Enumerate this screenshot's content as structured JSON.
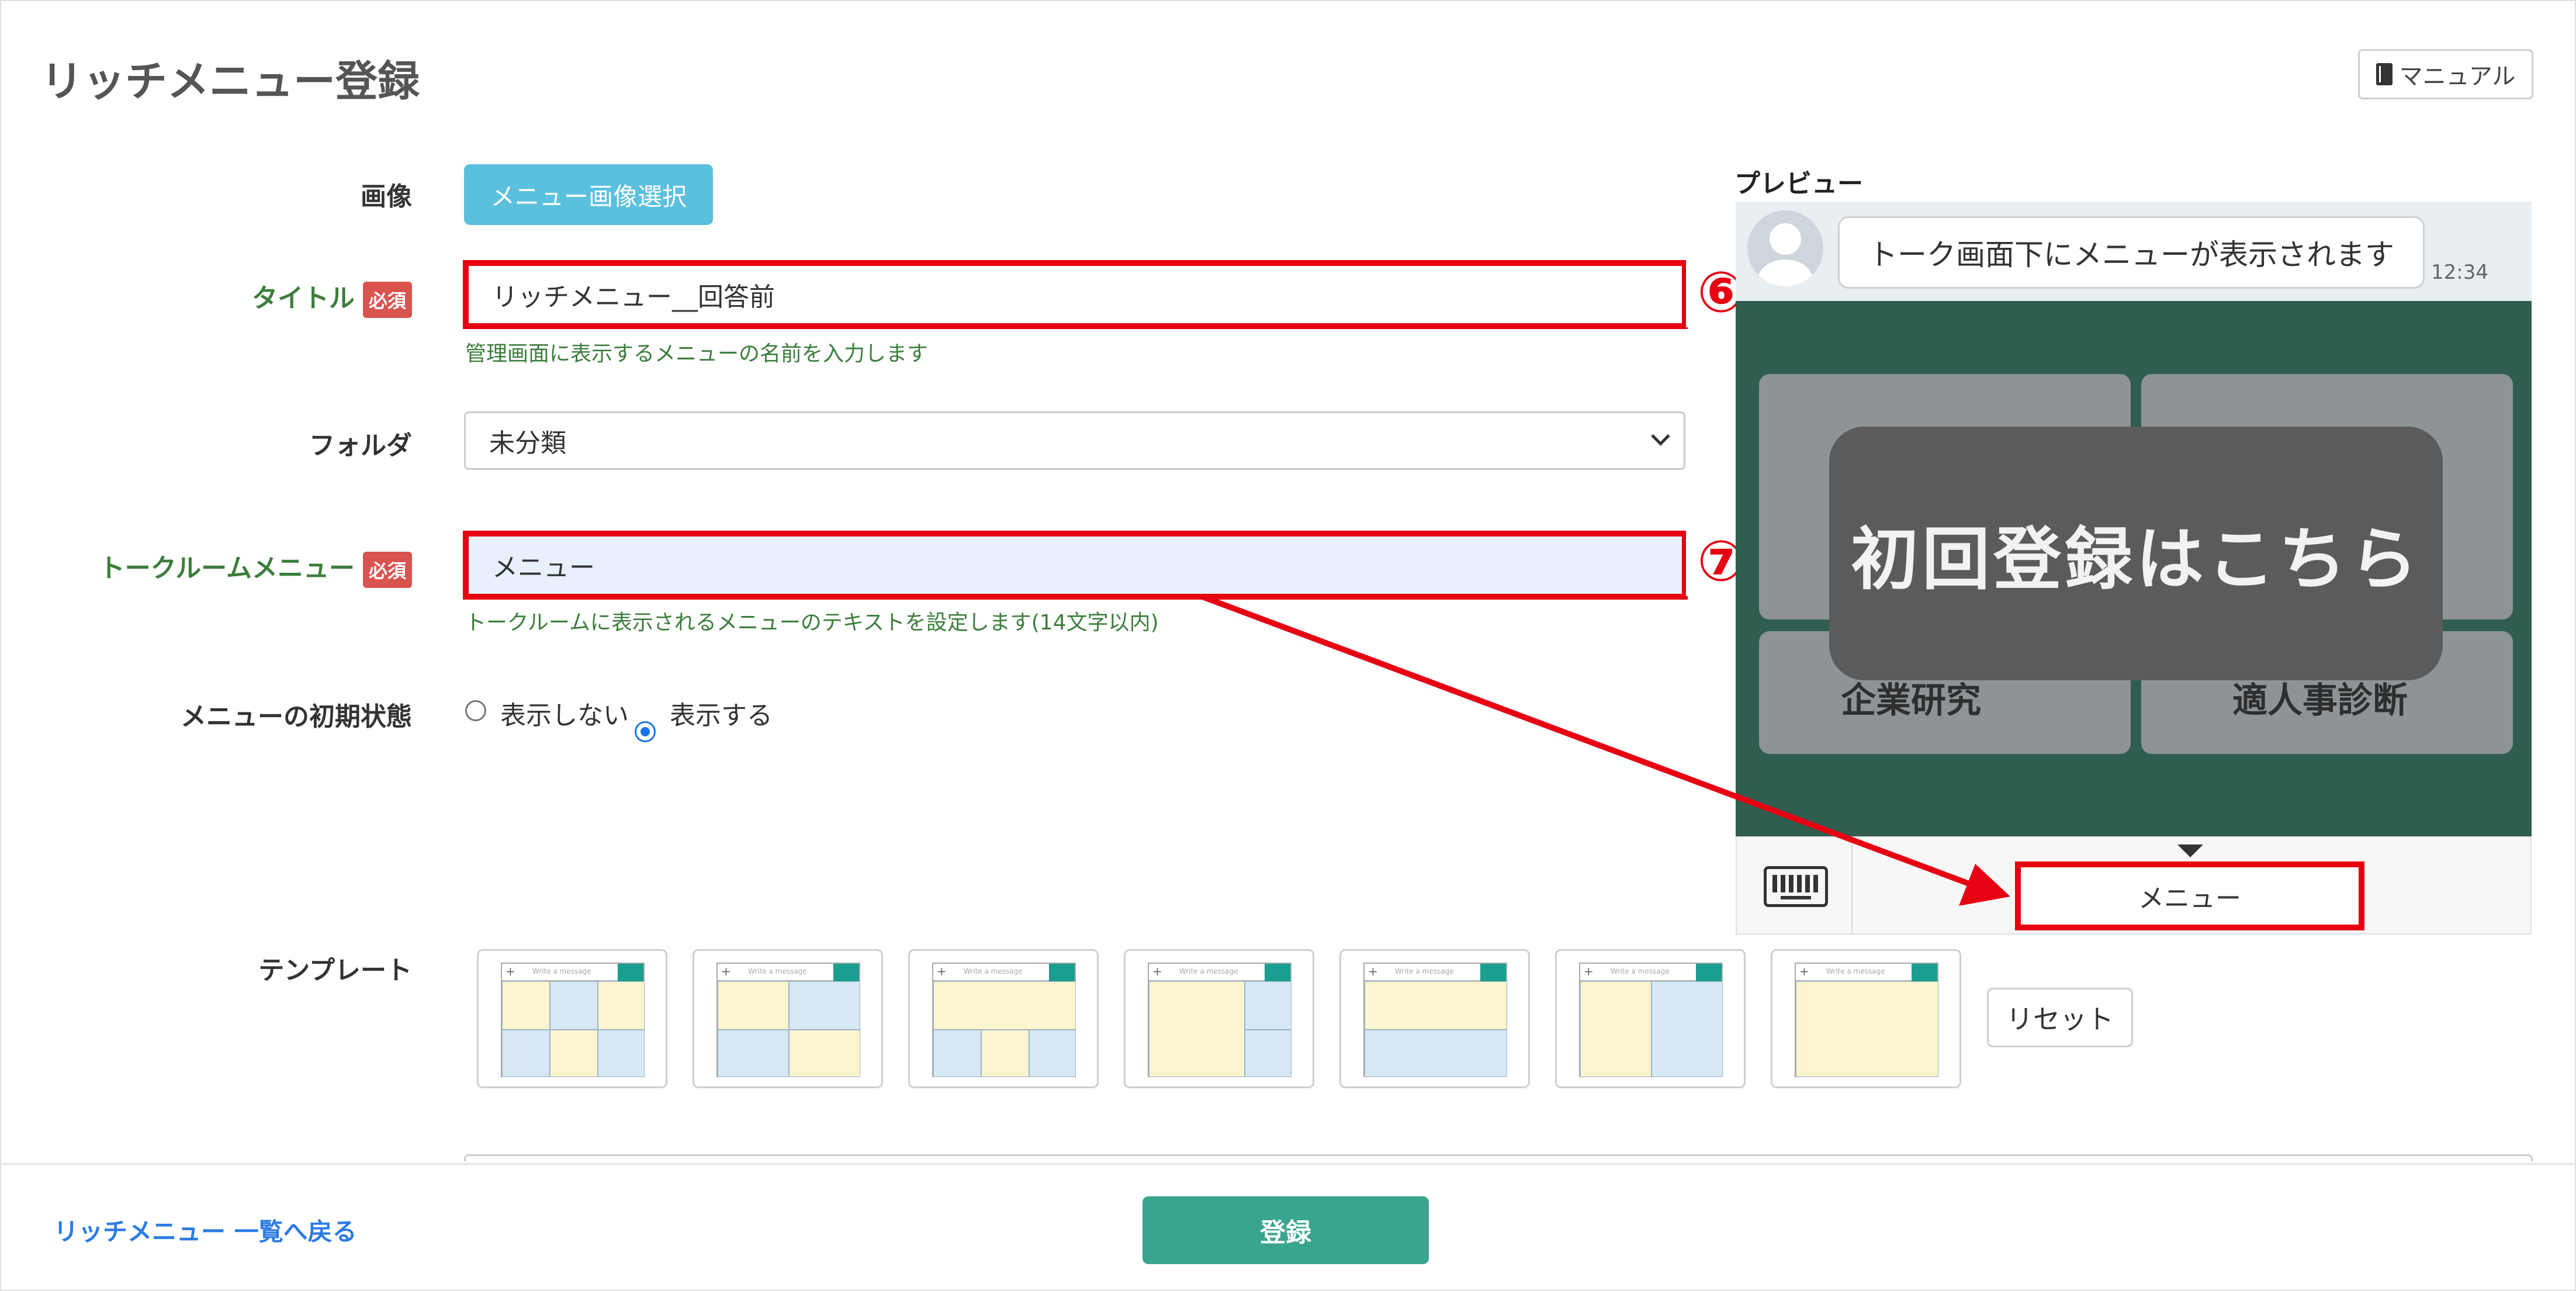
{
  "page": {
    "title": "リッチメニュー登録",
    "manual_label": "マニュアル"
  },
  "form": {
    "image": {
      "label": "画像",
      "button": "メニュー画像選択"
    },
    "title": {
      "label": "タイトル",
      "required": "必須",
      "value": "リッチメニュー__回答前",
      "help": "管理画面に表示するメニューの名前を入力します",
      "marker": "⑥"
    },
    "folder": {
      "label": "フォルダ",
      "selected": "未分類"
    },
    "talkroom_menu": {
      "label": "トークルームメニュー",
      "required": "必須",
      "value": "メニュー",
      "help": "トークルームに表示されるメニューのテキストを設定します(14文字以内)",
      "marker": "⑦"
    },
    "initial_state": {
      "label": "メニューの初期状態",
      "options": [
        "表示しない",
        "表示する"
      ],
      "selected": "表示する"
    },
    "template": {
      "label": "テンプレート",
      "reset": "リセット",
      "placeholder": "Write a message"
    }
  },
  "preview": {
    "label": "プレビュー",
    "message": "トーク画面下にメニューが表示されます",
    "time": "12:34",
    "overlay_text": "初回登録はこちら",
    "tile_labels": [
      "企業研究",
      "適人事診断"
    ],
    "menu_bar_label": "メニュー"
  },
  "footer": {
    "back_link": "リッチメニュー 一覧へ戻る",
    "submit": "登録"
  },
  "colors": {
    "annotation_red": "#e60012",
    "info_button": "#5bc0de",
    "submit_button": "#3aa58f",
    "required_badge": "#d9534f",
    "help_text": "#3c7d3c"
  }
}
